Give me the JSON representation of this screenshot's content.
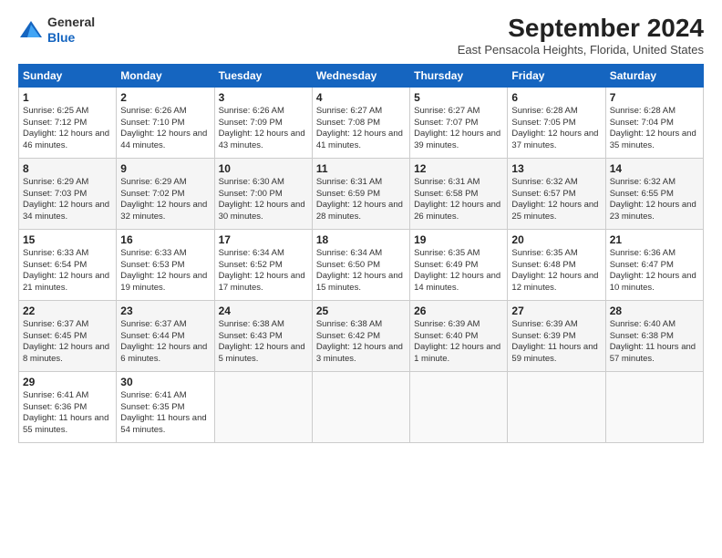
{
  "logo": {
    "general": "General",
    "blue": "Blue"
  },
  "title": "September 2024",
  "location": "East Pensacola Heights, Florida, United States",
  "days_header": [
    "Sunday",
    "Monday",
    "Tuesday",
    "Wednesday",
    "Thursday",
    "Friday",
    "Saturday"
  ],
  "weeks": [
    [
      {
        "day": "1",
        "sunrise": "Sunrise: 6:25 AM",
        "sunset": "Sunset: 7:12 PM",
        "daylight": "Daylight: 12 hours and 46 minutes."
      },
      {
        "day": "2",
        "sunrise": "Sunrise: 6:26 AM",
        "sunset": "Sunset: 7:10 PM",
        "daylight": "Daylight: 12 hours and 44 minutes."
      },
      {
        "day": "3",
        "sunrise": "Sunrise: 6:26 AM",
        "sunset": "Sunset: 7:09 PM",
        "daylight": "Daylight: 12 hours and 43 minutes."
      },
      {
        "day": "4",
        "sunrise": "Sunrise: 6:27 AM",
        "sunset": "Sunset: 7:08 PM",
        "daylight": "Daylight: 12 hours and 41 minutes."
      },
      {
        "day": "5",
        "sunrise": "Sunrise: 6:27 AM",
        "sunset": "Sunset: 7:07 PM",
        "daylight": "Daylight: 12 hours and 39 minutes."
      },
      {
        "day": "6",
        "sunrise": "Sunrise: 6:28 AM",
        "sunset": "Sunset: 7:05 PM",
        "daylight": "Daylight: 12 hours and 37 minutes."
      },
      {
        "day": "7",
        "sunrise": "Sunrise: 6:28 AM",
        "sunset": "Sunset: 7:04 PM",
        "daylight": "Daylight: 12 hours and 35 minutes."
      }
    ],
    [
      {
        "day": "8",
        "sunrise": "Sunrise: 6:29 AM",
        "sunset": "Sunset: 7:03 PM",
        "daylight": "Daylight: 12 hours and 34 minutes."
      },
      {
        "day": "9",
        "sunrise": "Sunrise: 6:29 AM",
        "sunset": "Sunset: 7:02 PM",
        "daylight": "Daylight: 12 hours and 32 minutes."
      },
      {
        "day": "10",
        "sunrise": "Sunrise: 6:30 AM",
        "sunset": "Sunset: 7:00 PM",
        "daylight": "Daylight: 12 hours and 30 minutes."
      },
      {
        "day": "11",
        "sunrise": "Sunrise: 6:31 AM",
        "sunset": "Sunset: 6:59 PM",
        "daylight": "Daylight: 12 hours and 28 minutes."
      },
      {
        "day": "12",
        "sunrise": "Sunrise: 6:31 AM",
        "sunset": "Sunset: 6:58 PM",
        "daylight": "Daylight: 12 hours and 26 minutes."
      },
      {
        "day": "13",
        "sunrise": "Sunrise: 6:32 AM",
        "sunset": "Sunset: 6:57 PM",
        "daylight": "Daylight: 12 hours and 25 minutes."
      },
      {
        "day": "14",
        "sunrise": "Sunrise: 6:32 AM",
        "sunset": "Sunset: 6:55 PM",
        "daylight": "Daylight: 12 hours and 23 minutes."
      }
    ],
    [
      {
        "day": "15",
        "sunrise": "Sunrise: 6:33 AM",
        "sunset": "Sunset: 6:54 PM",
        "daylight": "Daylight: 12 hours and 21 minutes."
      },
      {
        "day": "16",
        "sunrise": "Sunrise: 6:33 AM",
        "sunset": "Sunset: 6:53 PM",
        "daylight": "Daylight: 12 hours and 19 minutes."
      },
      {
        "day": "17",
        "sunrise": "Sunrise: 6:34 AM",
        "sunset": "Sunset: 6:52 PM",
        "daylight": "Daylight: 12 hours and 17 minutes."
      },
      {
        "day": "18",
        "sunrise": "Sunrise: 6:34 AM",
        "sunset": "Sunset: 6:50 PM",
        "daylight": "Daylight: 12 hours and 15 minutes."
      },
      {
        "day": "19",
        "sunrise": "Sunrise: 6:35 AM",
        "sunset": "Sunset: 6:49 PM",
        "daylight": "Daylight: 12 hours and 14 minutes."
      },
      {
        "day": "20",
        "sunrise": "Sunrise: 6:35 AM",
        "sunset": "Sunset: 6:48 PM",
        "daylight": "Daylight: 12 hours and 12 minutes."
      },
      {
        "day": "21",
        "sunrise": "Sunrise: 6:36 AM",
        "sunset": "Sunset: 6:47 PM",
        "daylight": "Daylight: 12 hours and 10 minutes."
      }
    ],
    [
      {
        "day": "22",
        "sunrise": "Sunrise: 6:37 AM",
        "sunset": "Sunset: 6:45 PM",
        "daylight": "Daylight: 12 hours and 8 minutes."
      },
      {
        "day": "23",
        "sunrise": "Sunrise: 6:37 AM",
        "sunset": "Sunset: 6:44 PM",
        "daylight": "Daylight: 12 hours and 6 minutes."
      },
      {
        "day": "24",
        "sunrise": "Sunrise: 6:38 AM",
        "sunset": "Sunset: 6:43 PM",
        "daylight": "Daylight: 12 hours and 5 minutes."
      },
      {
        "day": "25",
        "sunrise": "Sunrise: 6:38 AM",
        "sunset": "Sunset: 6:42 PM",
        "daylight": "Daylight: 12 hours and 3 minutes."
      },
      {
        "day": "26",
        "sunrise": "Sunrise: 6:39 AM",
        "sunset": "Sunset: 6:40 PM",
        "daylight": "Daylight: 12 hours and 1 minute."
      },
      {
        "day": "27",
        "sunrise": "Sunrise: 6:39 AM",
        "sunset": "Sunset: 6:39 PM",
        "daylight": "Daylight: 11 hours and 59 minutes."
      },
      {
        "day": "28",
        "sunrise": "Sunrise: 6:40 AM",
        "sunset": "Sunset: 6:38 PM",
        "daylight": "Daylight: 11 hours and 57 minutes."
      }
    ],
    [
      {
        "day": "29",
        "sunrise": "Sunrise: 6:41 AM",
        "sunset": "Sunset: 6:36 PM",
        "daylight": "Daylight: 11 hours and 55 minutes."
      },
      {
        "day": "30",
        "sunrise": "Sunrise: 6:41 AM",
        "sunset": "Sunset: 6:35 PM",
        "daylight": "Daylight: 11 hours and 54 minutes."
      },
      null,
      null,
      null,
      null,
      null
    ]
  ]
}
